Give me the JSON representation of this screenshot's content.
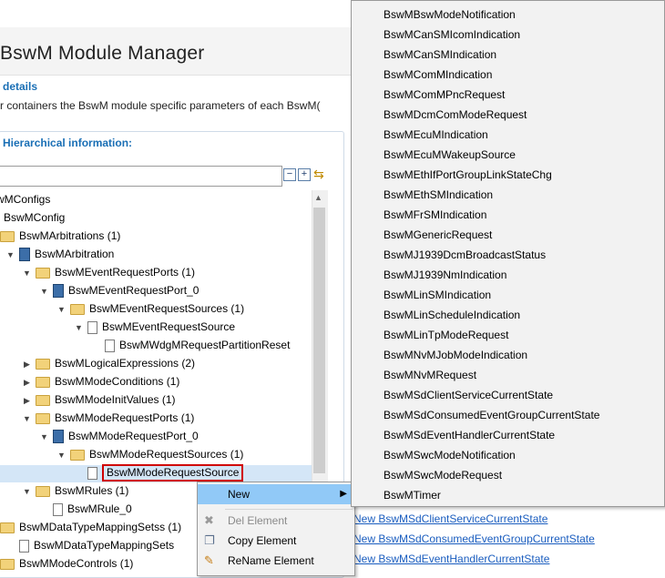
{
  "header": {
    "title": "BswM Module Manager"
  },
  "details": {
    "heading": "details",
    "description": "r containers the BswM module specific parameters of each BswM("
  },
  "hierarchy": {
    "heading": "Hierarchical information:",
    "filter_value": ""
  },
  "tree": [
    {
      "label": "wMConfigs",
      "indent": 0,
      "toggle": "",
      "icon": "none"
    },
    {
      "label": "BswMConfig",
      "indent": 0,
      "toggle": "",
      "icon": "none"
    },
    {
      "label": "BswMArbitrations (1)",
      "indent": 0,
      "toggle": "",
      "icon": "folder"
    },
    {
      "label": "BswMArbitration",
      "indent": 1,
      "toggle": "▼",
      "icon": "module"
    },
    {
      "label": "BswMEventRequestPorts (1)",
      "indent": 2,
      "toggle": "▼",
      "icon": "folder"
    },
    {
      "label": "BswMEventRequestPort_0",
      "indent": 3,
      "toggle": "▼",
      "icon": "module"
    },
    {
      "label": "BswMEventRequestSources (1)",
      "indent": 4,
      "toggle": "▼",
      "icon": "folder"
    },
    {
      "label": "BswMEventRequestSource",
      "indent": 5,
      "toggle": "▼",
      "icon": "doc"
    },
    {
      "label": "BswMWdgMRequestPartitionReset",
      "indent": 6,
      "toggle": "",
      "icon": "doc"
    },
    {
      "label": "BswMLogicalExpressions (2)",
      "indent": 2,
      "toggle": "▶",
      "icon": "folder"
    },
    {
      "label": "BswMModeConditions (1)",
      "indent": 2,
      "toggle": "▶",
      "icon": "folder"
    },
    {
      "label": "BswMModeInitValues (1)",
      "indent": 2,
      "toggle": "▶",
      "icon": "folder"
    },
    {
      "label": "BswMModeRequestPorts (1)",
      "indent": 2,
      "toggle": "▼",
      "icon": "folder"
    },
    {
      "label": "BswMModeRequestPort_0",
      "indent": 3,
      "toggle": "▼",
      "icon": "module"
    },
    {
      "label": "BswMModeRequestSources (1)",
      "indent": 4,
      "toggle": "▼",
      "icon": "folder"
    },
    {
      "label": "BswMModeRequestSource",
      "indent": 5,
      "toggle": "",
      "icon": "doc",
      "selected": true
    },
    {
      "label": "BswMRules (1)",
      "indent": 2,
      "toggle": "▼",
      "icon": "folder"
    },
    {
      "label": "BswMRule_0",
      "indent": 3,
      "toggle": "",
      "icon": "doc"
    },
    {
      "label": "BswMDataTypeMappingSetss (1)",
      "indent": 0,
      "toggle": "",
      "icon": "folder"
    },
    {
      "label": "BswMDataTypeMappingSets",
      "indent": 1,
      "toggle": "",
      "icon": "doc"
    },
    {
      "label": "BswMModeControls (1)",
      "indent": 0,
      "toggle": "",
      "icon": "folder"
    }
  ],
  "links": [
    "New BswMSdClientServiceCurrentState",
    "New BswMSdConsumedEventGroupCurrentState",
    "New BswMSdEventHandlerCurrentState"
  ],
  "context_menu": {
    "new_label": "New",
    "del_label": "Del Element",
    "copy_label": "Copy Element",
    "rename_label": "ReName Element"
  },
  "submenu": [
    "BswMBswModeNotification",
    "BswMCanSMIcomIndication",
    "BswMCanSMIndication",
    "BswMComMIndication",
    "BswMComMPncRequest",
    "BswMDcmComModeRequest",
    "BswMEcuMIndication",
    "BswMEcuMWakeupSource",
    "BswMEthIfPortGroupLinkStateChg",
    "BswMEthSMIndication",
    "BswMFrSMIndication",
    "BswMGenericRequest",
    "BswMJ1939DcmBroadcastStatus",
    "BswMJ1939NmIndication",
    "BswMLinSMIndication",
    "BswMLinScheduleIndication",
    "BswMLinTpModeRequest",
    "BswMNvMJobModeIndication",
    "BswMNvMRequest",
    "BswMSdClientServiceCurrentState",
    "BswMSdConsumedEventGroupCurrentState",
    "BswMSdEventHandlerCurrentState",
    "BswMSwcModeNotification",
    "BswMSwcModeRequest",
    "BswMTimer"
  ]
}
